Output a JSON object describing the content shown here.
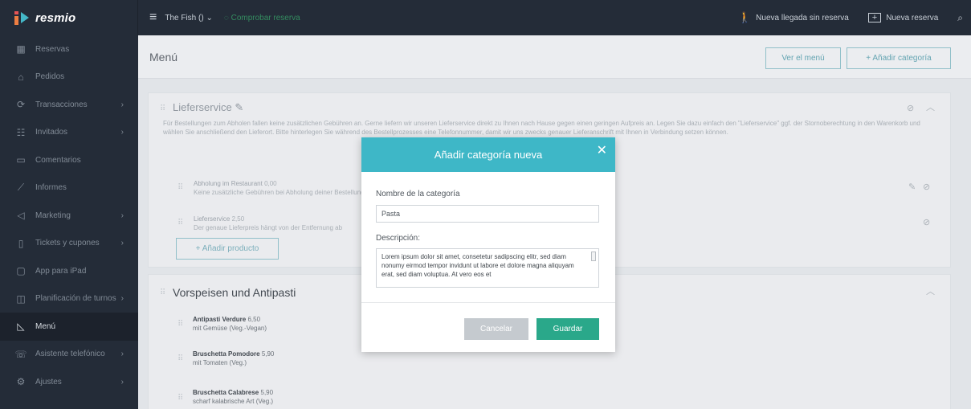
{
  "topbar": {
    "brand": "resmio",
    "restaurant": "The Fish ()",
    "status": "Comprobar reserva",
    "walkin": "Nueva llegada sin reserva",
    "new_reservation": "Nueva reserva"
  },
  "sidebar": {
    "items": [
      {
        "label": "Reservas",
        "icon": "calendar-icon",
        "chevron": false
      },
      {
        "label": "Pedidos",
        "icon": "bag-icon",
        "chevron": false
      },
      {
        "label": "Transacciones",
        "icon": "transactions-icon",
        "chevron": true
      },
      {
        "label": "Invitados",
        "icon": "guests-icon",
        "chevron": true
      },
      {
        "label": "Comentarios",
        "icon": "comments-icon",
        "chevron": false
      },
      {
        "label": "Informes",
        "icon": "chart-icon",
        "chevron": false
      },
      {
        "label": "Marketing",
        "icon": "megaphone-icon",
        "chevron": true
      },
      {
        "label": "Tickets y cupones",
        "icon": "ticket-icon",
        "chevron": true
      },
      {
        "label": "App para iPad",
        "icon": "ipad-icon",
        "chevron": false
      },
      {
        "label": "Planificación de turnos",
        "icon": "shifts-icon",
        "chevron": true
      },
      {
        "label": "Menú",
        "icon": "menu-icon",
        "chevron": false,
        "active": true
      },
      {
        "label": "Asistente telefónico",
        "icon": "phone-icon",
        "chevron": true
      },
      {
        "label": "Ajustes",
        "icon": "settings-icon",
        "chevron": true
      }
    ]
  },
  "header": {
    "title": "Menú",
    "view_menu": "Ver el menú",
    "add_category": "+ Añadir categoría"
  },
  "category1": {
    "title": "Lieferservice",
    "description": "Für Bestellungen zum Abholen fallen keine zusätzlichen Gebühren an. Gerne liefern wir unseren Lieferservice direkt zu Ihnen nach Hause gegen einen geringen Aufpreis an. Legen Sie dazu einfach den \"Lieferservice\" ggf. der Stornoberechtung in den Warenkorb und wählen Sie anschließend den Lieferort. Bitte hinterlegen Sie während des Bestellprozesses eine Telefonnummer, damit wir uns zwecks genauer Lieferanschrift mit Ihnen in Verbindung setzen können.",
    "products": [
      {
        "name": "Abholung im Restaurant",
        "price": "0,00",
        "note": "Keine zusätzliche Gebühren bei Abholung deiner Bestellung"
      },
      {
        "name": "Lieferservice",
        "price": "2,50",
        "note": "Der genaue Lieferpreis hängt von der Entfernung ab"
      }
    ],
    "add_product": "+ Añadir producto"
  },
  "category2": {
    "title": "Vorspeisen und Antipasti",
    "products": [
      {
        "name": "Antipasti Verdure",
        "price": "6,50",
        "note": "mit Gemüse (Veg.-Vegan)"
      },
      {
        "name": "Bruschetta Pomodore",
        "price": "5,90",
        "note": "mit Tomaten (Veg.)"
      },
      {
        "name": "Bruschetta Calabrese",
        "price": "5,90",
        "note": "scharf kalabrische Art (Veg.)"
      }
    ]
  },
  "modal": {
    "title": "Añadir categoría nueva",
    "name_label": "Nombre de la categoría",
    "name_value": "Pasta",
    "desc_label": "Descripción:",
    "desc_value": "Lorem ipsum dolor sit amet, consetetur sadipscing elitr, sed diam nonumy eirmod tempor invidunt ut labore et dolore magna aliquyam erat, sed diam voluptua. At vero eos et",
    "cancel": "Cancelar",
    "save": "Guardar"
  },
  "colors": {
    "sidebar": "#1c2430",
    "accent": "#3eb7c7",
    "save": "#2aa88a"
  }
}
